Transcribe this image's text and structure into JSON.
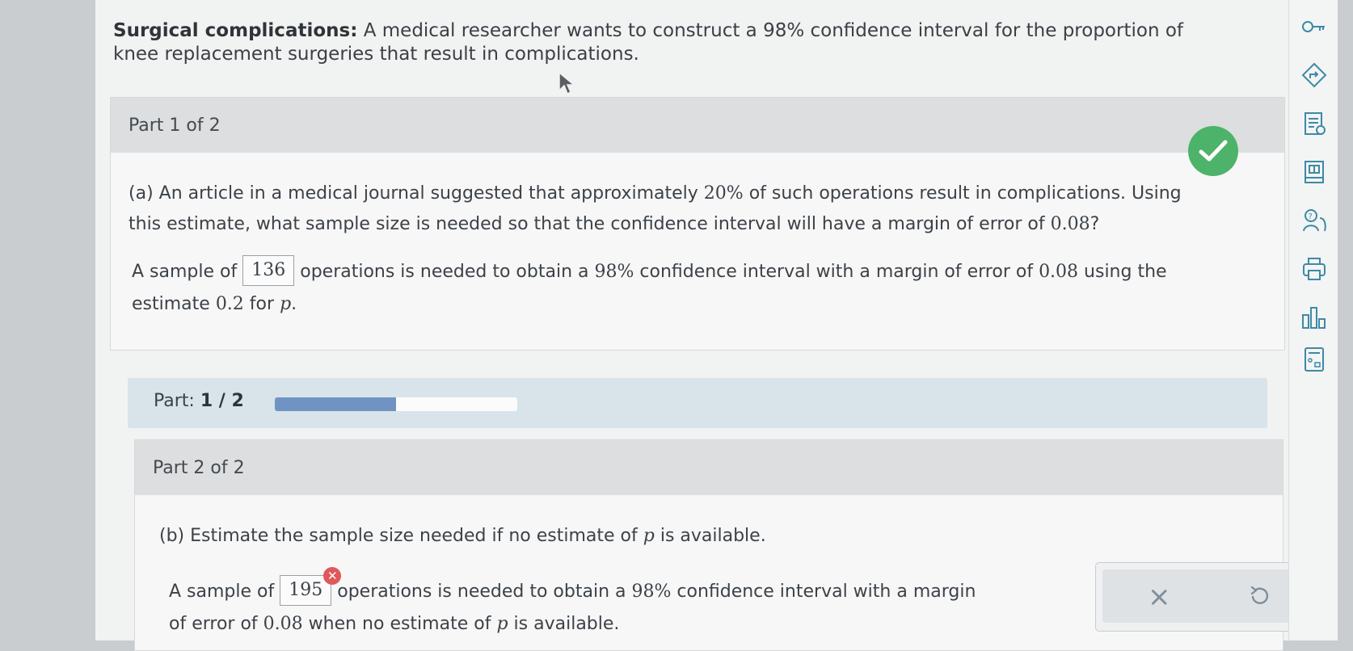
{
  "problem": {
    "title_bold": "Surgical complications:",
    "title_rest": " A medical researcher wants to construct a 98% confidence interval for the proportion of knee replacement surgeries that result in complications."
  },
  "part1": {
    "header": "Part 1 of 2",
    "question_a": "(a) An article in a medical journal suggested that approximately ",
    "question_a_pct": "20%",
    "question_a_mid": " of such operations result in complications. Using this estimate, what sample size is needed so that the confidence interval will have a margin of error of ",
    "question_a_moe": "0.08",
    "question_a_end": "?",
    "answer_prefix": "A sample of ",
    "answer_value": "136",
    "answer_mid": " operations is needed to obtain a ",
    "answer_conf": "98%",
    "answer_mid2": " confidence interval with a margin of error of ",
    "answer_moe": "0.08",
    "answer_mid3": " using the estimate ",
    "answer_p": "0.2",
    "answer_for": " for ",
    "answer_var": "p",
    "answer_end": ".",
    "status": "correct"
  },
  "progress": {
    "label": "Part:",
    "value": "1 / 2",
    "fraction": 0.5
  },
  "part2": {
    "header": "Part 2 of 2",
    "question_b": "(b) Estimate the sample size needed if no estimate of ",
    "question_b_var": "p",
    "question_b_end": " is available.",
    "answer_prefix": "A sample of ",
    "answer_value": "195",
    "answer_mid": " operations is needed to obtain a ",
    "answer_conf": "98%",
    "answer_mid2": " confidence interval with a margin of error of ",
    "answer_moe": "0.08",
    "answer_mid3": " when no estimate of ",
    "answer_var": "p",
    "answer_end": " is available.",
    "status": "incorrect",
    "clear_label": "×"
  },
  "colors": {
    "correct": "#4db36a",
    "incorrect": "#e0595a",
    "progress_fill": "#6f94c3"
  },
  "toolbar": {
    "icons": [
      "key-icon",
      "navigate-icon",
      "notes-icon",
      "book-icon",
      "help-icon",
      "print-icon",
      "chart-icon",
      "calculator-icon"
    ]
  }
}
